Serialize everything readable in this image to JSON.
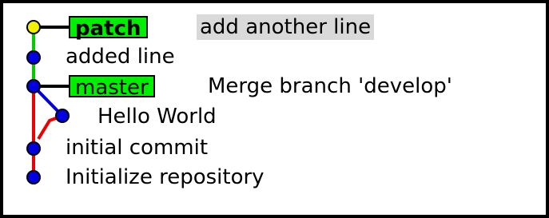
{
  "colors": {
    "window_bg": "#000000",
    "canvas_bg": "#ffffff",
    "branch_tag_bg": "#00ee00",
    "node_normal": "#0000e0",
    "node_head": "#f0f000",
    "edge_patch": "#00cc00",
    "edge_master": "#0000e0",
    "edge_develop_merge": "#ee0000",
    "selection_bg": "#d9d9d9"
  },
  "commits": [
    {
      "message": "add another line",
      "branch": "patch",
      "node": "commit-dot-head"
    },
    {
      "message": "added line",
      "node": "commit-dot"
    },
    {
      "message": "Merge branch 'develop'",
      "branch": "master",
      "node": "commit-dot"
    },
    {
      "message": "Hello World",
      "node": "commit-dot"
    },
    {
      "message": "initial commit",
      "node": "commit-dot"
    },
    {
      "message": "Initialize repository",
      "node": "commit-dot"
    }
  ]
}
